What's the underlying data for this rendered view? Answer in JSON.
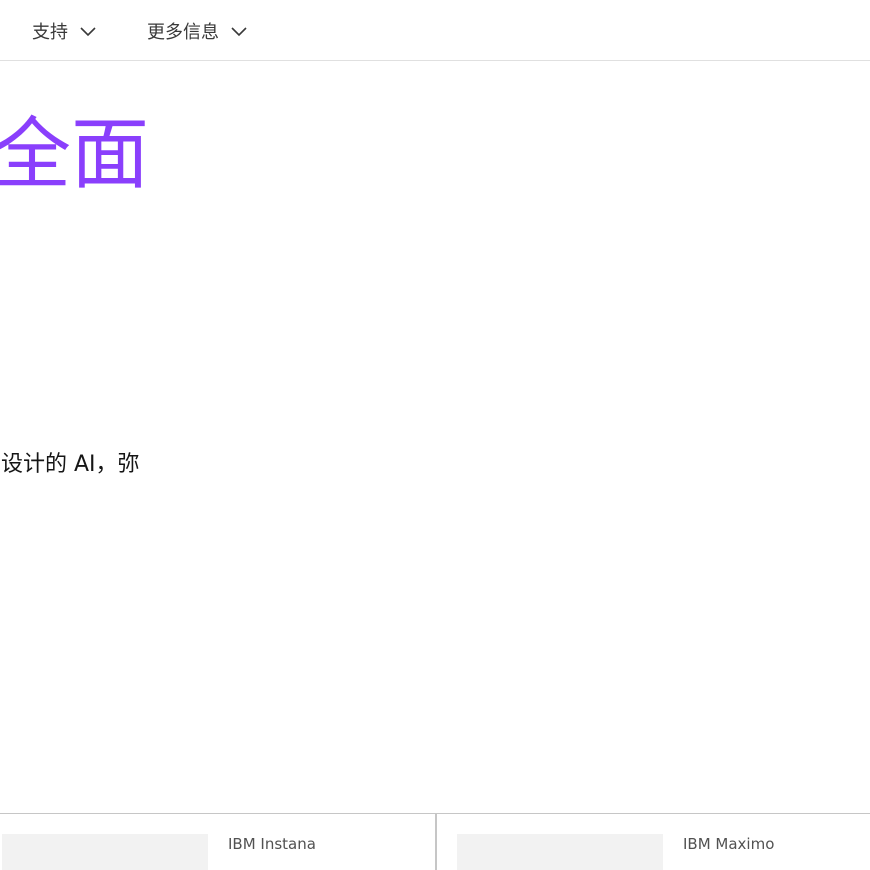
{
  "nav": {
    "items": [
      {
        "label": "支持",
        "icon": "chevron-down-icon"
      },
      {
        "label": "更多信息",
        "icon": "chevron-down-icon"
      }
    ]
  },
  "hero": {
    "title": "全面",
    "title_color": "#8a3ffc",
    "text": "设计的 AI，弥"
  },
  "cards": [
    {
      "eyebrow": "IBM Instana",
      "heading": ""
    },
    {
      "eyebrow": "IBM Maximo",
      "heading": ""
    }
  ]
}
